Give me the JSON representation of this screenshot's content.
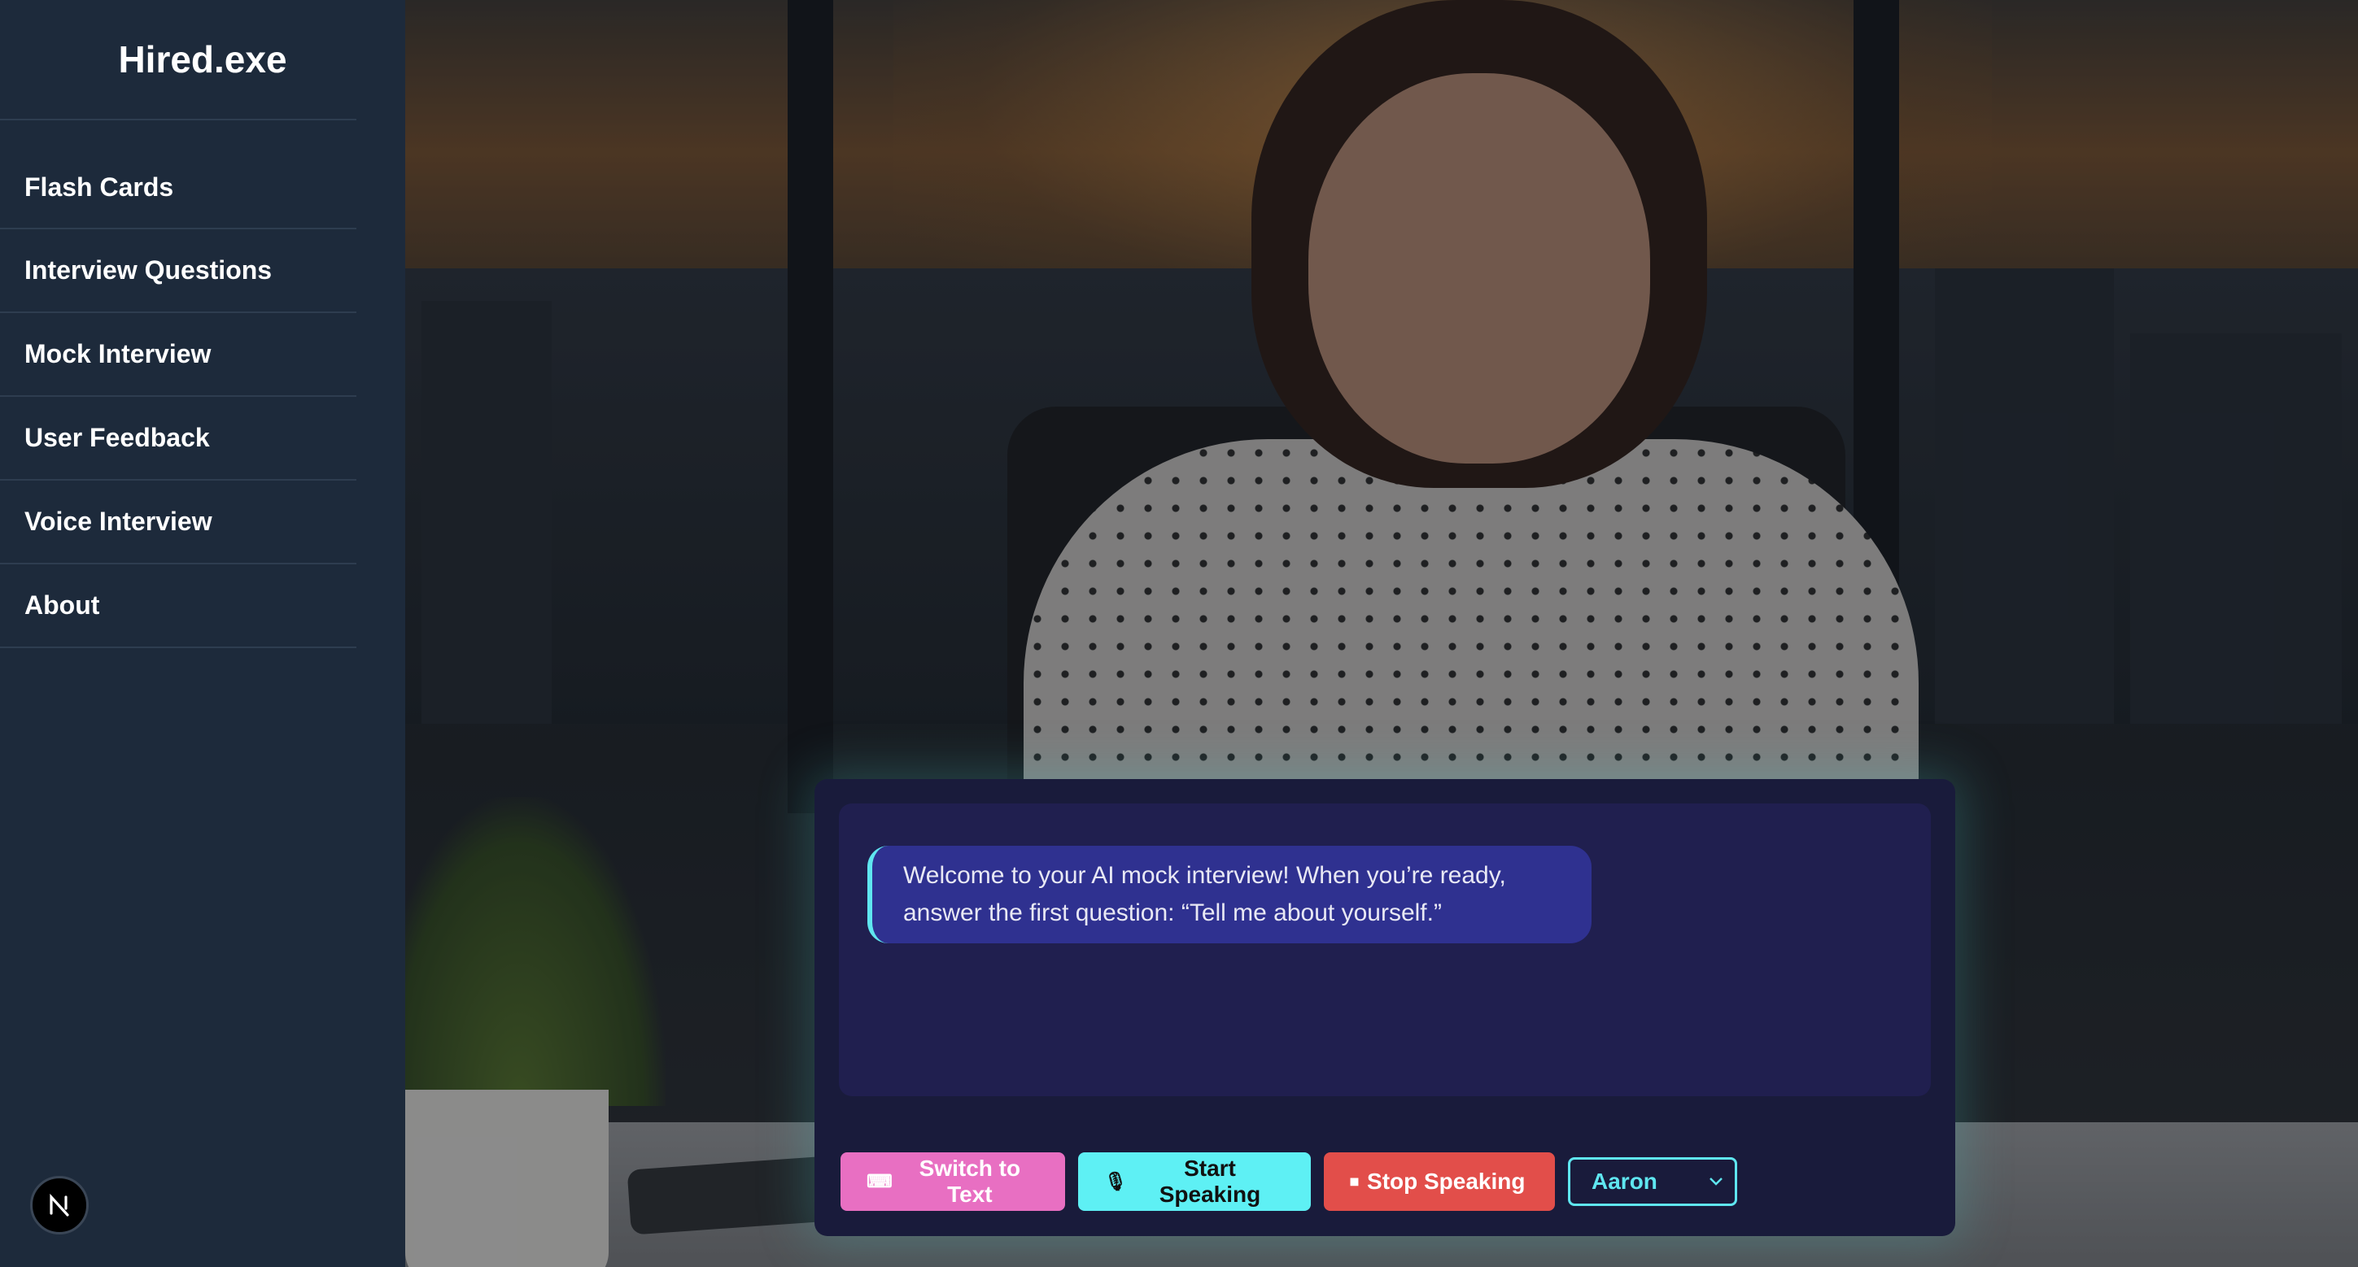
{
  "app": {
    "title": "Hired.exe"
  },
  "sidebar": {
    "items": [
      {
        "label": "Flash Cards"
      },
      {
        "label": "Interview Questions"
      },
      {
        "label": "Mock Interview"
      },
      {
        "label": "User Feedback"
      },
      {
        "label": "Voice Interview"
      },
      {
        "label": "About"
      }
    ],
    "badge_letter": "N"
  },
  "chat": {
    "message": "Welcome to your AI mock interview! When you’re ready, answer the first question: “Tell me about yourself.”"
  },
  "controls": {
    "switch_label": "Switch to Text",
    "start_label": "Start Speaking",
    "stop_label": "Stop Speaking",
    "voice_selected": "Aaron"
  },
  "colors": {
    "sidebar_bg": "#1d2a3b",
    "panel_bg": "#191b3b",
    "bubble_bg": "#2f3190",
    "accent_cyan": "#5ef0f4",
    "accent_pink": "#e86fc2",
    "accent_red": "#e24e4a"
  }
}
